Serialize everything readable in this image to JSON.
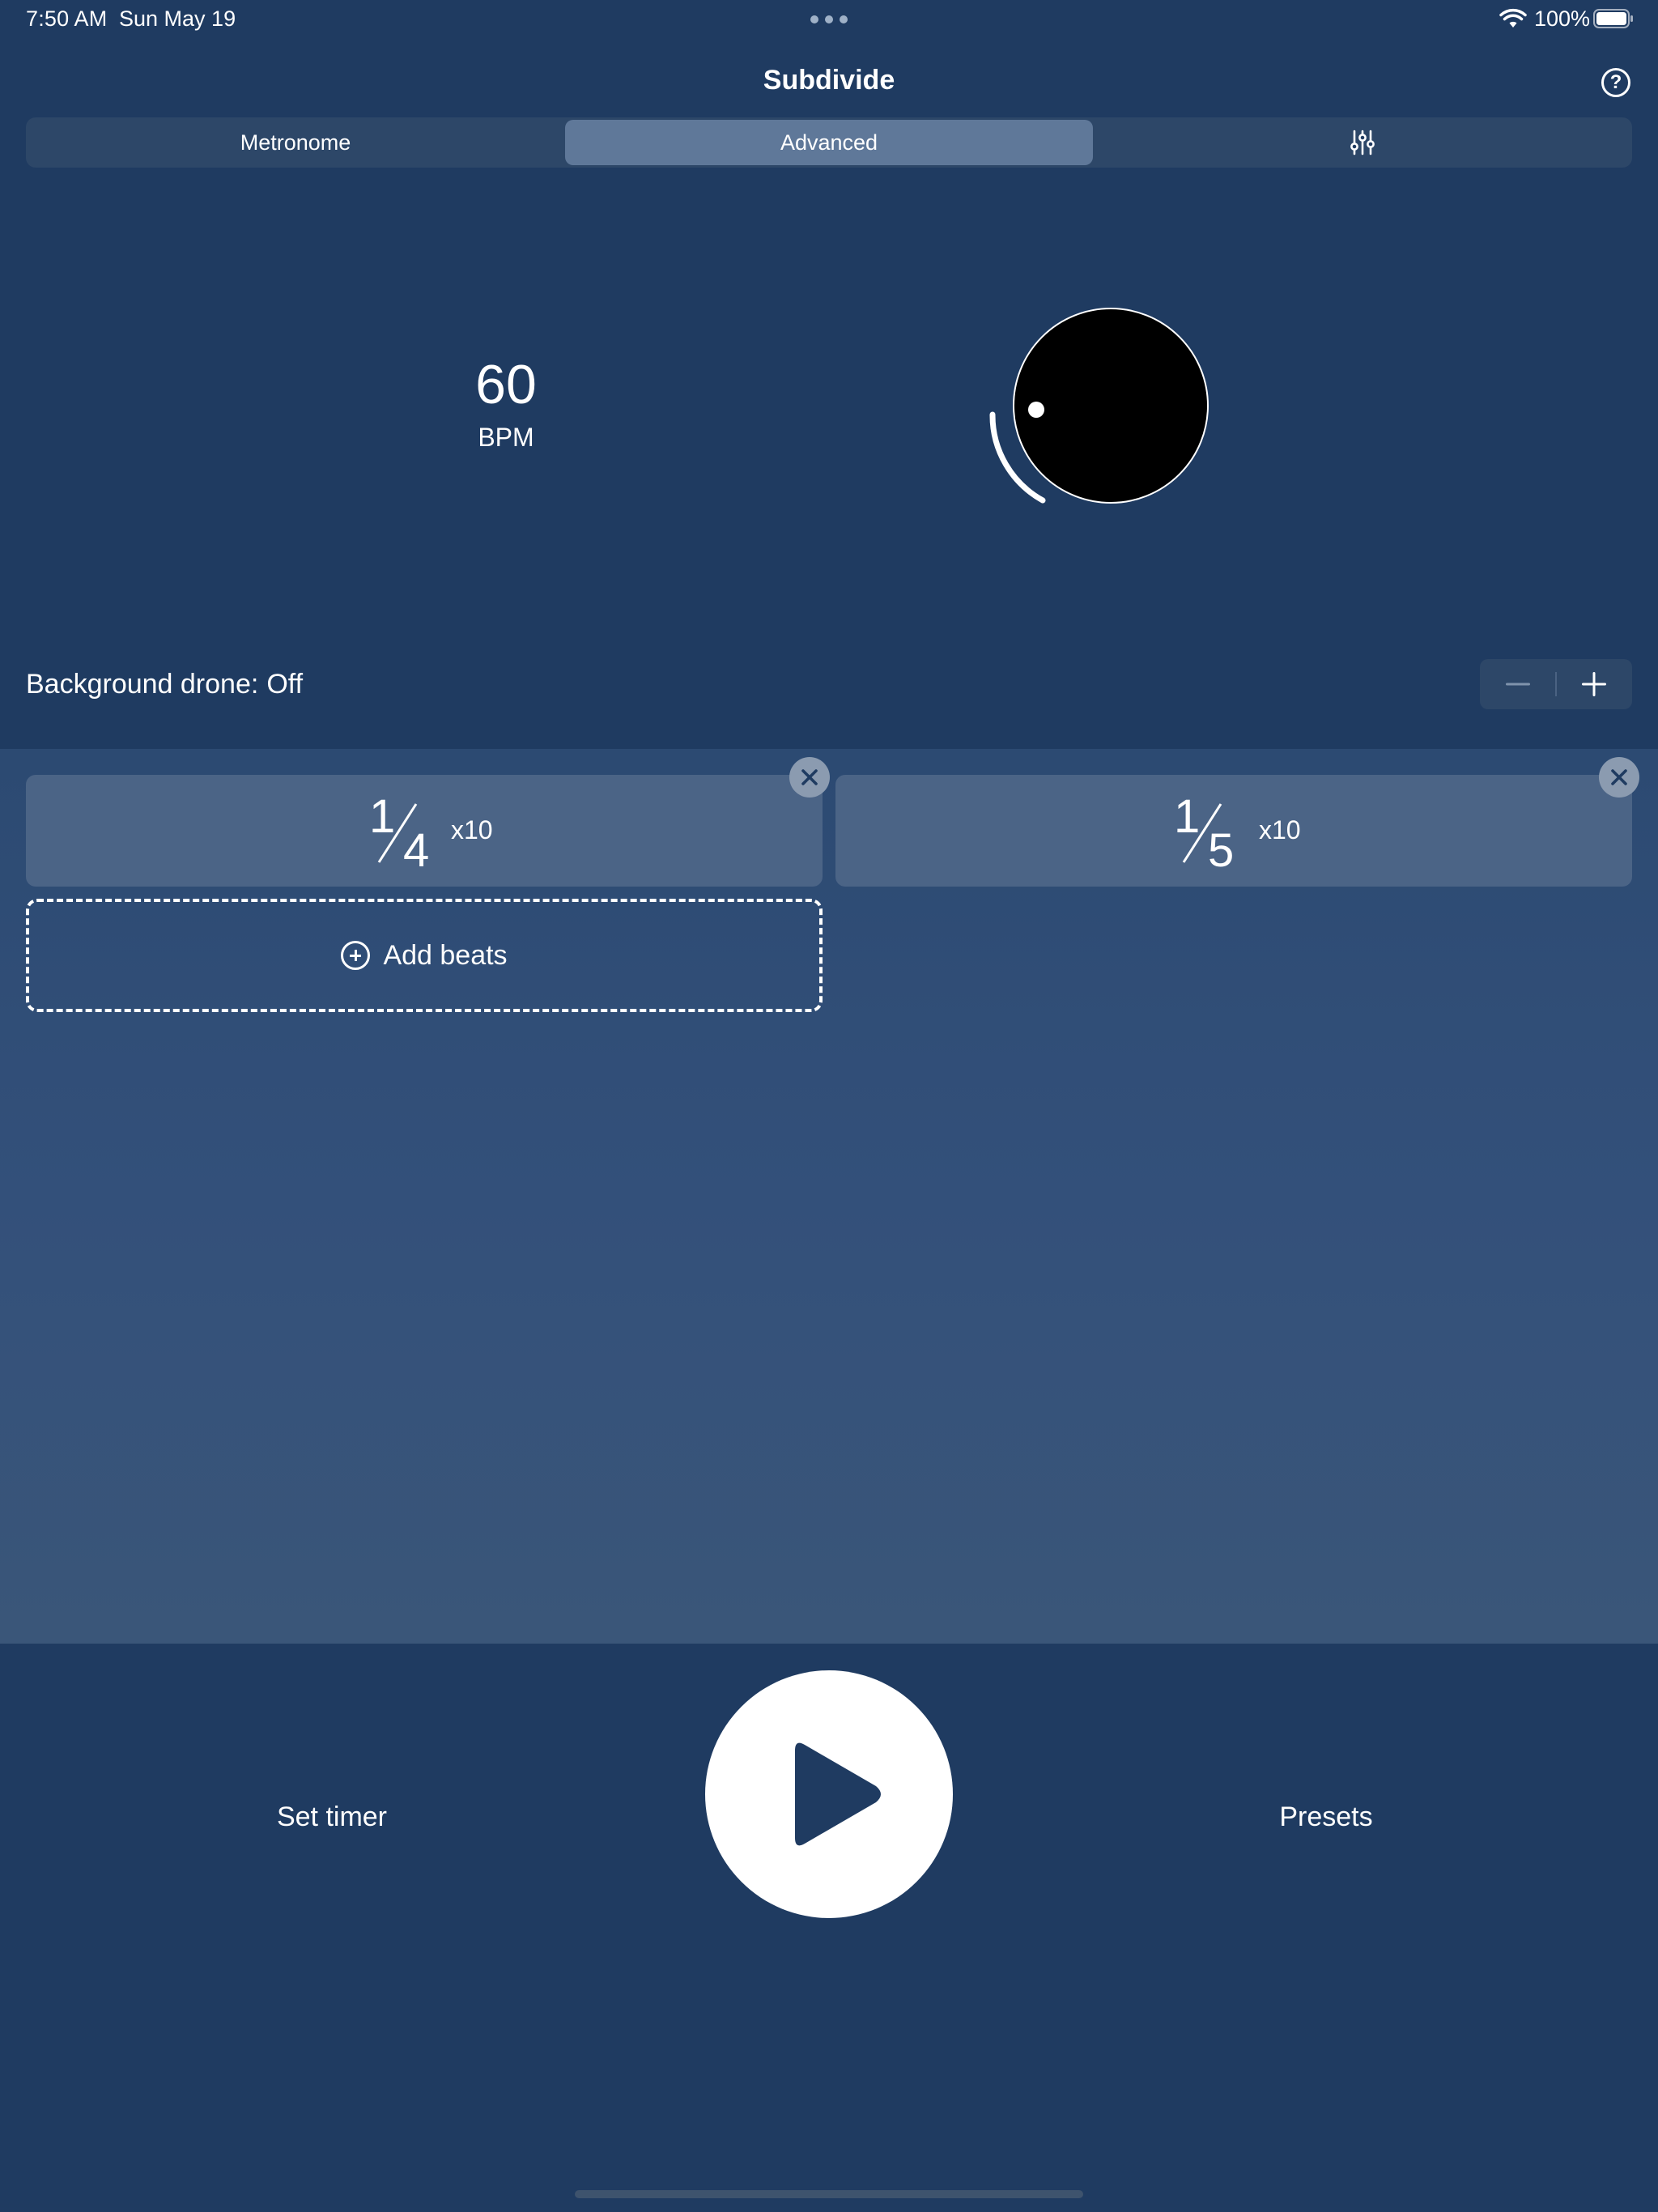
{
  "status_bar": {
    "time": "7:50 AM",
    "date": "Sun May 19",
    "battery_percent": "100%",
    "icons": [
      "multitasking-dots-icon",
      "wifi-icon",
      "battery-icon"
    ]
  },
  "header": {
    "title": "Subdivide",
    "help_label": "?"
  },
  "tabs": [
    {
      "label": "Metronome",
      "selected": false
    },
    {
      "label": "Advanced",
      "selected": true
    },
    {
      "label": "",
      "icon": "mixer-sliders-icon",
      "selected": false
    }
  ],
  "tempo": {
    "bpm": "60",
    "unit": "BPM"
  },
  "drone": {
    "label": "Background drone:",
    "value": "Off"
  },
  "beats": [
    {
      "numerator": "1",
      "denominator": "4",
      "repeat": "x10"
    },
    {
      "numerator": "1",
      "denominator": "5",
      "repeat": "x10"
    }
  ],
  "add_beats_label": "Add beats",
  "footer": {
    "timer_label": "Set timer",
    "presets_label": "Presets"
  },
  "colors": {
    "background": "#1f3b61",
    "beats_area": "#33507a",
    "card": "#4b6486",
    "segment_selected": "#5f7899",
    "text": "#ffffff"
  }
}
